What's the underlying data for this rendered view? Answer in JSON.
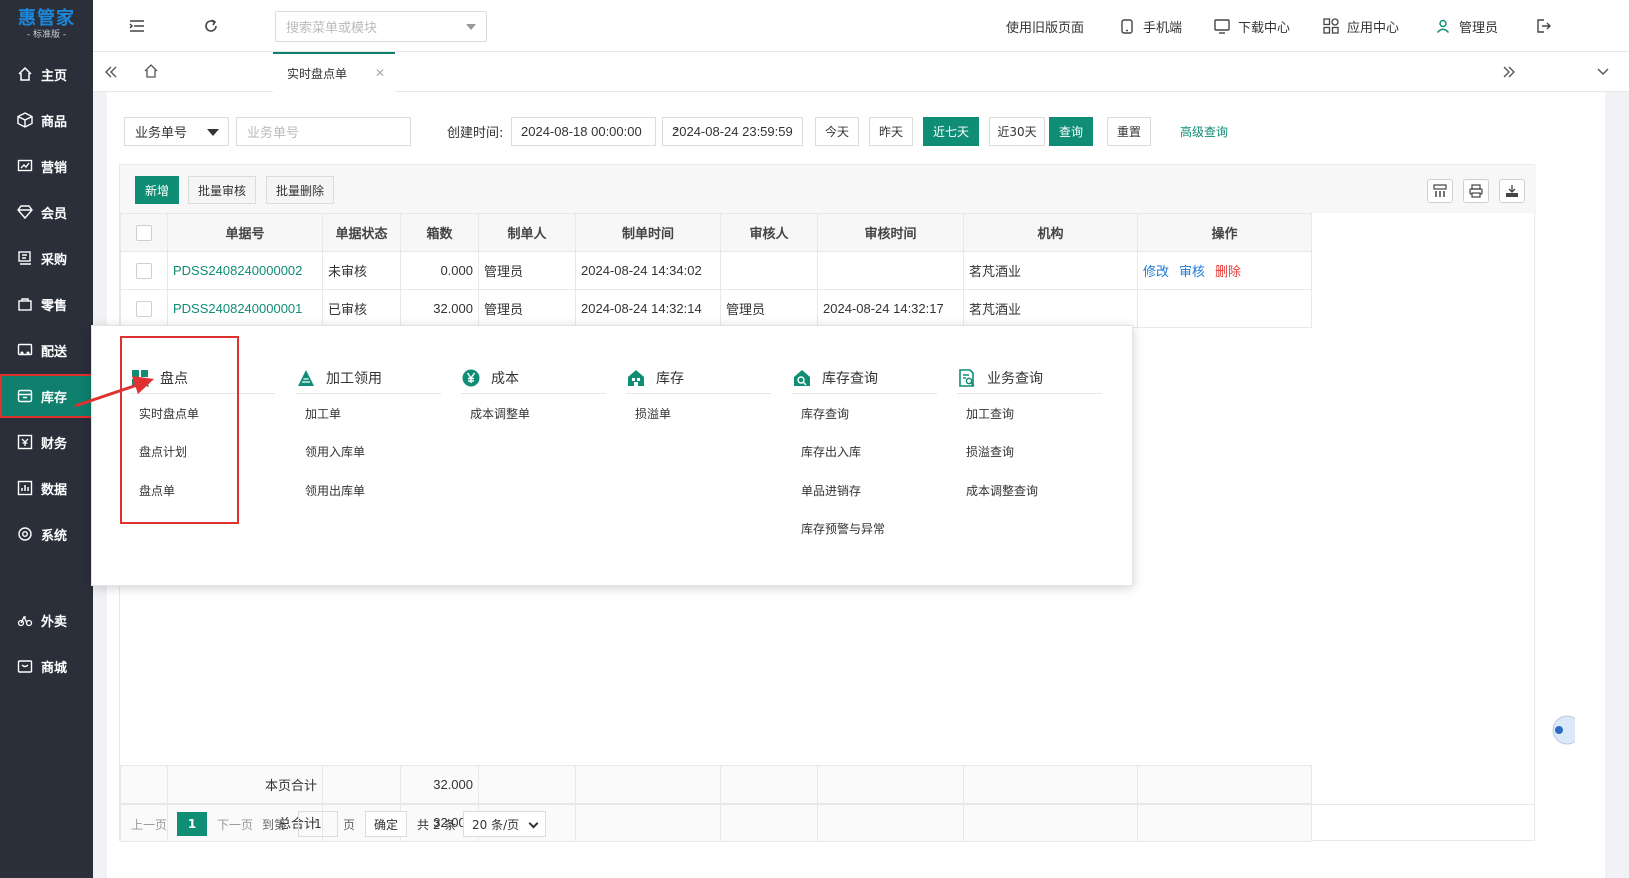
{
  "sidebar": {
    "logo_main": "惠管家",
    "logo_sub": "- 标准版 -",
    "items": [
      {
        "label": "主页",
        "icon": "home-icon"
      },
      {
        "label": "商品",
        "icon": "box-icon"
      },
      {
        "label": "营销",
        "icon": "chart-icon"
      },
      {
        "label": "会员",
        "icon": "diamond-icon"
      },
      {
        "label": "采购",
        "icon": "purchase-icon"
      },
      {
        "label": "零售",
        "icon": "bag-icon"
      },
      {
        "label": "配送",
        "icon": "truck-icon"
      },
      {
        "label": "库存",
        "icon": "inventory-icon"
      },
      {
        "label": "财务",
        "icon": "finance-icon"
      },
      {
        "label": "数据",
        "icon": "data-icon"
      },
      {
        "label": "系统",
        "icon": "system-icon"
      },
      {
        "label": "外卖",
        "icon": "bike-icon"
      },
      {
        "label": "商城",
        "icon": "shop-icon"
      }
    ]
  },
  "topbar": {
    "search_placeholder": "搜索菜单或模块",
    "old_version": "使用旧版页面",
    "mobile": "手机端",
    "download": "下载中心",
    "apps": "应用中心",
    "user": "管理员"
  },
  "tabs": {
    "active_label": "实时盘点单"
  },
  "filter": {
    "type_select": "业务单号",
    "input_placeholder": "业务单号",
    "date_label": "创建时间:",
    "date_start": "2024-08-18 00:00:00",
    "date_sep": "-",
    "date_end": "2024-08-24 23:59:59",
    "btn_today": "今天",
    "btn_yesterday": "昨天",
    "btn_7days": "近七天",
    "btn_30days": "近30天",
    "btn_query": "查询",
    "btn_reset": "重置",
    "link_advanced": "高级查询"
  },
  "toolbar": {
    "add": "新增",
    "batch_audit": "批量审核",
    "batch_delete": "批量删除"
  },
  "table": {
    "headers": [
      "单据号",
      "单据状态",
      "箱数",
      "制单人",
      "制单时间",
      "审核人",
      "审核时间",
      "机构",
      "操作"
    ],
    "rows": [
      {
        "doc_no": "PDSS2408240000002",
        "status": "未审核",
        "boxes": "0.000",
        "creator": "管理员",
        "created": "2024-08-24 14:34:02",
        "auditor": "",
        "audited": "",
        "org": "茗芃酒业",
        "ops": [
          "修改",
          "审核",
          "删除"
        ]
      },
      {
        "doc_no": "PDSS2408240000001",
        "status": "已审核",
        "boxes": "32.000",
        "creator": "管理员",
        "created": "2024-08-24 14:32:14",
        "auditor": "管理员",
        "audited": "2024-08-24 14:32:17",
        "org": "茗芃酒业",
        "ops": []
      }
    ],
    "page_total_label": "本页合计",
    "page_total": "32.000",
    "grand_total_label": "总合计",
    "grand_total": "32.000"
  },
  "pager": {
    "prev": "上一页",
    "current": "1",
    "next": "下一页",
    "goto": "到第",
    "page_input": "1",
    "page_unit": "页",
    "confirm": "确定",
    "total": "共 2 条",
    "size": "20 条/页"
  },
  "popup": {
    "columns": [
      {
        "title": "盘点",
        "icon": "grid-search-icon",
        "items": [
          "实时盘点单",
          "盘点计划",
          "盘点单"
        ]
      },
      {
        "title": "加工领用",
        "icon": "triangle-icon",
        "items": [
          "加工单",
          "领用入库单",
          "领用出库单"
        ]
      },
      {
        "title": "成本",
        "icon": "yen-icon",
        "items": [
          "成本调整单"
        ]
      },
      {
        "title": "库存",
        "icon": "house-icon",
        "items": [
          "损溢单"
        ]
      },
      {
        "title": "库存查询",
        "icon": "house-search-icon",
        "items": [
          "库存查询",
          "库存出入库",
          "单品进销存",
          "库存预警与异常"
        ]
      },
      {
        "title": "业务查询",
        "icon": "doc-search-icon",
        "items": [
          "加工查询",
          "损溢查询",
          "成本调整查询"
        ]
      }
    ]
  },
  "colors": {
    "sidebar_bg": "#2b2f3a",
    "accent": "#0f8d75",
    "link_blue": "#1e7bd9",
    "danger": "#e53935",
    "highlight": "#e03131"
  }
}
